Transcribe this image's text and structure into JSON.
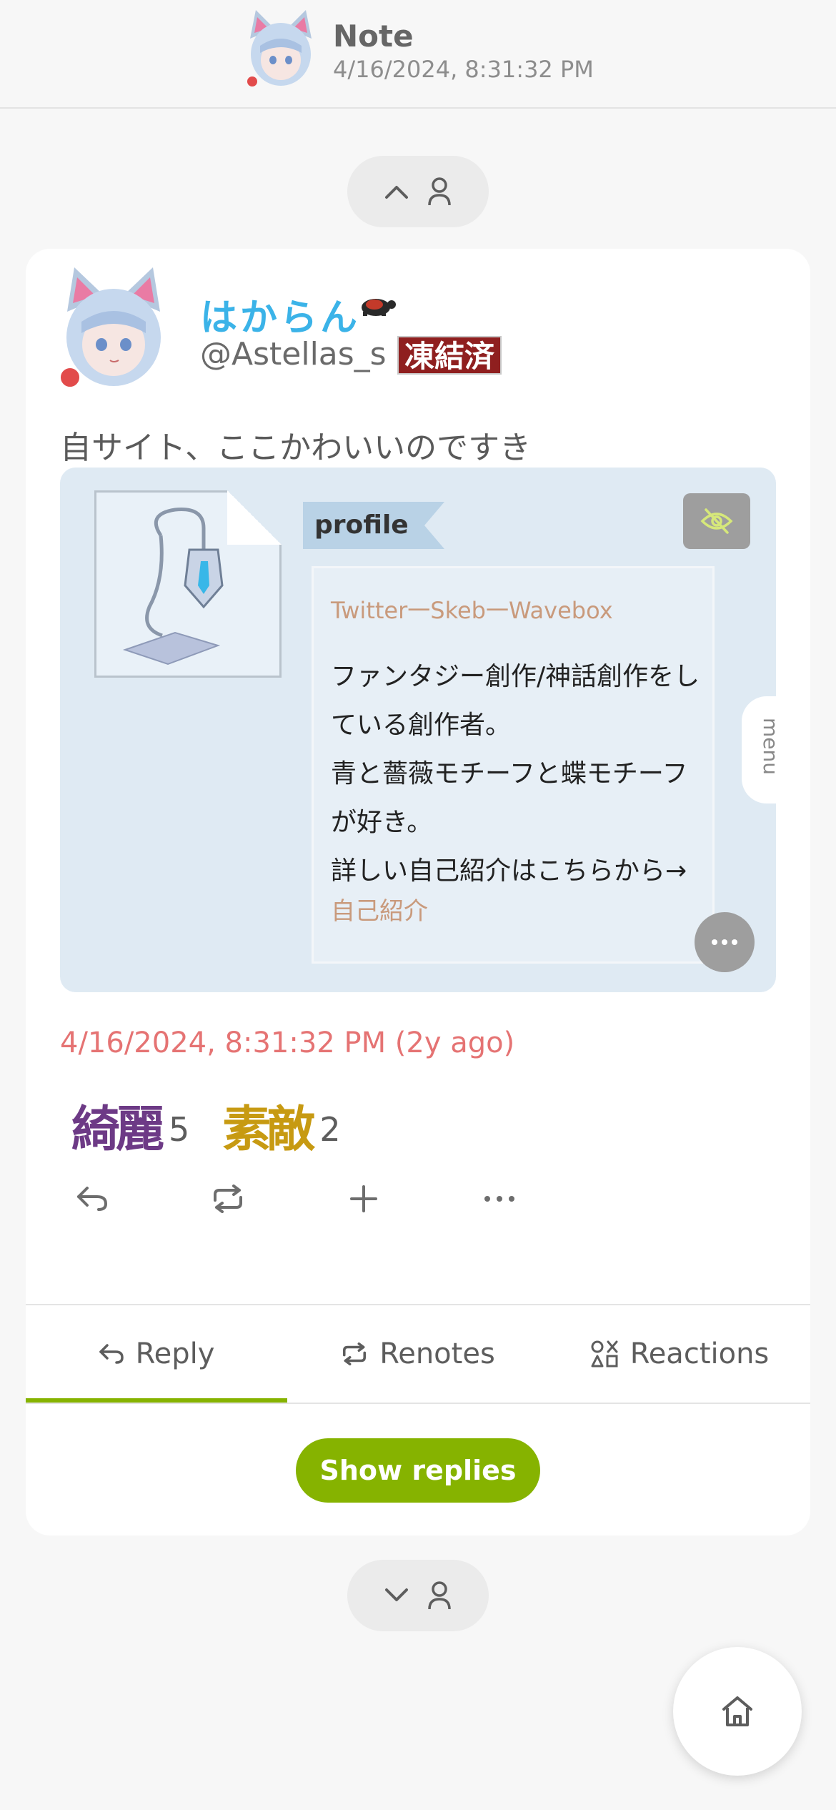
{
  "header": {
    "title": "Note",
    "timestamp": "4/16/2024, 8:31:32 PM"
  },
  "note": {
    "display_name": "はからん",
    "username": "@Astellas_s",
    "badge": "凍結済",
    "text": "自サイト、ここかわいいのですき",
    "time": "4/16/2024, 8:31:32 PM (2y ago)",
    "image": {
      "label": "profile",
      "links": "Twitter一Skeb一Wavebox",
      "description": "ファンタジー創作/神話創作をしている創作者。\n青と薔薇モチーフと蝶モチーフが好き。\n詳しい自己紹介はこちらから→",
      "intro_link": "自己紹介",
      "menu_tab": "menu"
    },
    "reactions": [
      {
        "emoji": "綺麗",
        "count": "5"
      },
      {
        "emoji": "素敵",
        "count": "2"
      }
    ]
  },
  "tabs": [
    {
      "label": "Reply",
      "icon": "reply-icon"
    },
    {
      "label": "Renotes",
      "icon": "repeat-icon"
    },
    {
      "label": "Reactions",
      "icon": "shapes-icon"
    }
  ],
  "show_replies_label": "Show replies",
  "colors": {
    "accent": "#86b300",
    "timestamp": "#e57373",
    "display_name": "#3bb3e8",
    "badge": "#8f1f1f"
  }
}
